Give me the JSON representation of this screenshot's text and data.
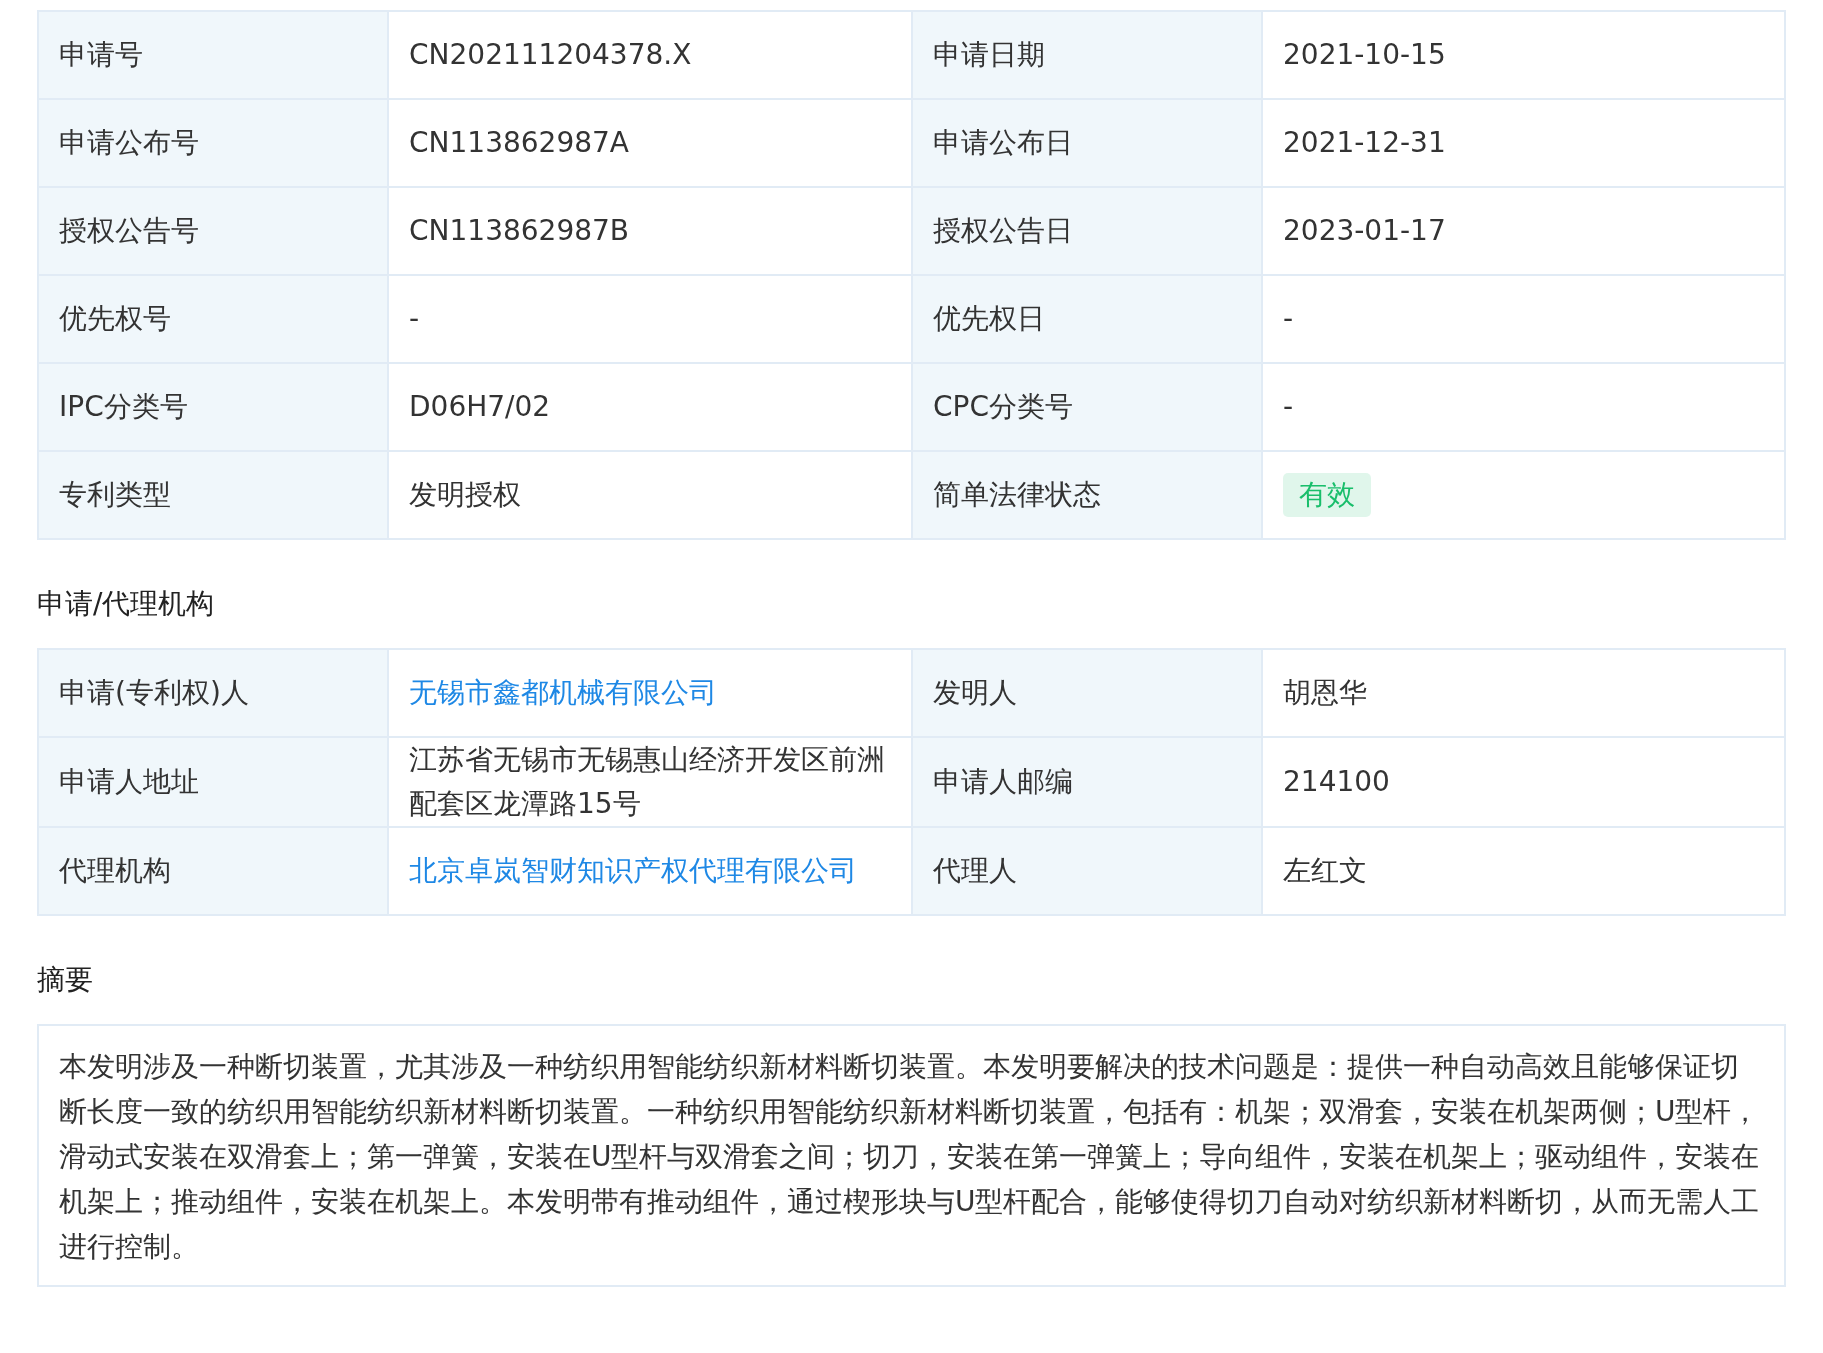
{
  "basic_table": {
    "rows": [
      {
        "label": "申请号",
        "value": {
          "kind": "text",
          "text": "CN202111204378.X"
        },
        "label_2": "申请日期",
        "value_2": {
          "kind": "text",
          "text": "2021-10-15"
        }
      },
      {
        "label": "申请公布号",
        "value": {
          "kind": "text",
          "text": "CN113862987A"
        },
        "label_2": "申请公布日",
        "value_2": {
          "kind": "text",
          "text": "2021-12-31"
        }
      },
      {
        "label": "授权公告号",
        "value": {
          "kind": "text",
          "text": "CN113862987B"
        },
        "label_2": "授权公告日",
        "value_2": {
          "kind": "text",
          "text": "2023-01-17"
        }
      },
      {
        "label": "优先权号",
        "value": {
          "kind": "text",
          "text": "-"
        },
        "label_2": "优先权日",
        "value_2": {
          "kind": "text",
          "text": "-"
        }
      },
      {
        "label": "IPC分类号",
        "value": {
          "kind": "text",
          "text": "D06H7/02"
        },
        "label_2": "CPC分类号",
        "value_2": {
          "kind": "text",
          "text": "-"
        }
      },
      {
        "label": "专利类型",
        "value": {
          "kind": "text",
          "text": "发明授权"
        },
        "label_2": "简单法律状态",
        "value_2": {
          "kind": "badge",
          "text": "有效",
          "color": "#19be6b"
        }
      }
    ]
  },
  "agency_section": {
    "title": "申请/代理机构",
    "rows": [
      {
        "label": "申请(专利权)人",
        "value": {
          "kind": "link",
          "text": "无锡市鑫都机械有限公司"
        },
        "label_2": "发明人",
        "value_2": {
          "kind": "text",
          "text": "胡恩华"
        }
      },
      {
        "label": "申请人地址",
        "value": {
          "kind": "text",
          "text": "江苏省无锡市无锡惠山经济开发区前洲配套区龙潭路15号"
        },
        "label_2": "申请人邮编",
        "value_2": {
          "kind": "text",
          "text": "214100"
        }
      },
      {
        "label": "代理机构",
        "value": {
          "kind": "link",
          "text": "北京卓岚智财知识产权代理有限公司"
        },
        "label_2": "代理人",
        "value_2": {
          "kind": "text",
          "text": "左红文"
        }
      }
    ]
  },
  "abstract_section": {
    "title": "摘要",
    "text": "本发明涉及一种断切装置，尤其涉及一种纺织用智能纺织新材料断切装置。本发明要解决的技术问题是：提供一种自动高效且能够保证切断长度一致的纺织用智能纺织新材料断切装置。一种纺织用智能纺织新材料断切装置，包括有：机架；双滑套，安装在机架两侧；U型杆，滑动式安装在双滑套上；第一弹簧，安装在U型杆与双滑套之间；切刀，安装在第一弹簧上；导向组件，安装在机架上；驱动组件，安装在机架上；推动组件，安装在机架上。本发明带有推动组件，通过楔形块与U型杆配合，能够使得切刀自动对纺织新材料断切，从而无需人工进行控制。"
  }
}
